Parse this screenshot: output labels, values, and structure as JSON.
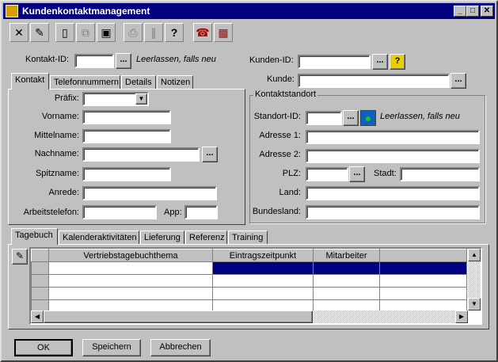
{
  "window": {
    "title": "Kundenkontaktmanagement"
  },
  "toolbar": {
    "buttons": [
      {
        "icon": "cancel-x-icon",
        "glyph": "✕"
      },
      {
        "icon": "eraser-icon",
        "glyph": "✎"
      },
      {
        "icon": "new-document-icon",
        "glyph": "🗋"
      },
      {
        "icon": "copy-icon",
        "glyph": "⧉"
      },
      {
        "icon": "save-disk-icon",
        "glyph": "💾"
      },
      {
        "icon": "print-icon",
        "glyph": "⎙"
      },
      {
        "icon": "attach-icon",
        "glyph": "⧗"
      },
      {
        "icon": "help-icon",
        "glyph": "?"
      },
      {
        "icon": "contact-search-icon",
        "glyph": "☎"
      },
      {
        "icon": "building-icon",
        "glyph": "▦"
      }
    ]
  },
  "contact": {
    "id_label": "Kontakt-ID:",
    "id_value": "",
    "id_hint": "Leerlassen, falls neu",
    "tabs": [
      "Kontakt",
      "Telefonnummern",
      "Details",
      "Notizen"
    ],
    "prefix_label": "Präfix:",
    "prefix_value": "",
    "firstname_label": "Vorname:",
    "middlename_label": "Mittelname:",
    "lastname_label": "Nachname:",
    "nickname_label": "Spitzname:",
    "salutation_label": "Anrede:",
    "workphone_label": "Arbeitstelefon:",
    "ext_label": "App:"
  },
  "customer": {
    "id_label": "Kunden-ID:",
    "id_value": "",
    "name_label": "Kunde:",
    "name_value": ""
  },
  "site": {
    "group_label": "Kontaktstandort",
    "id_label": "Standort-ID:",
    "id_hint": "Leerlassen, falls neu",
    "addr1_label": "Adresse 1:",
    "addr2_label": "Adresse 2:",
    "zip_label": "PLZ:",
    "city_label": "Stadt:",
    "country_label": "Land:",
    "state_label": "Bundesland:"
  },
  "log": {
    "tabs": [
      "Tagebuch",
      "Kalenderaktivitäten",
      "Lieferung",
      "Referenz",
      "Training"
    ],
    "columns": [
      "Vertriebstagebuchthema",
      "Eintragszeitpunkt",
      "Mitarbeiter",
      ""
    ],
    "rows": [
      [
        "",
        "",
        "",
        ""
      ],
      [
        "",
        "",
        "",
        ""
      ],
      [
        "",
        "",
        "",
        ""
      ],
      [
        "",
        "",
        "",
        ""
      ]
    ]
  },
  "footer": {
    "ok_label": "OK",
    "save_label": "Speichern",
    "cancel_label": "Abbrechen"
  },
  "dots_label": "...",
  "colors": {
    "titlebar": "#000080",
    "selection": "#000080",
    "face": "#c0c0c0"
  }
}
